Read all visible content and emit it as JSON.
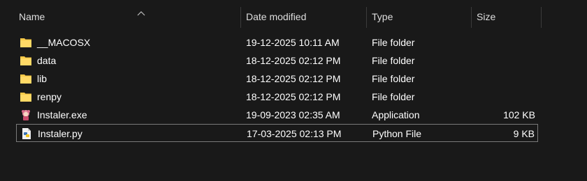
{
  "columns": {
    "name": "Name",
    "date": "Date modified",
    "type": "Type",
    "size": "Size"
  },
  "sort": {
    "column": "name",
    "direction": "ascending"
  },
  "files": [
    {
      "name": "__MACOSX",
      "date": "19-12-2025 10:11 AM",
      "type": "File folder",
      "size": "",
      "icon": "folder-icon"
    },
    {
      "name": "data",
      "date": "18-12-2025 02:12 PM",
      "type": "File folder",
      "size": "",
      "icon": "folder-icon"
    },
    {
      "name": "lib",
      "date": "18-12-2025 02:12 PM",
      "type": "File folder",
      "size": "",
      "icon": "folder-icon"
    },
    {
      "name": "renpy",
      "date": "18-12-2025 02:12 PM",
      "type": "File folder",
      "size": "",
      "icon": "folder-icon"
    },
    {
      "name": "Instaler.exe",
      "date": "19-09-2023 02:35 AM",
      "type": "Application",
      "size": "102 KB",
      "icon": "application-icon"
    },
    {
      "name": "Instaler.py",
      "date": "17-03-2025 02:13 PM",
      "type": "Python File",
      "size": "9 KB",
      "icon": "python-file-icon",
      "selected": true
    }
  ],
  "colors": {
    "background": "#191919",
    "folder": "#f7c948",
    "selection_border": "#7a7a7a"
  }
}
